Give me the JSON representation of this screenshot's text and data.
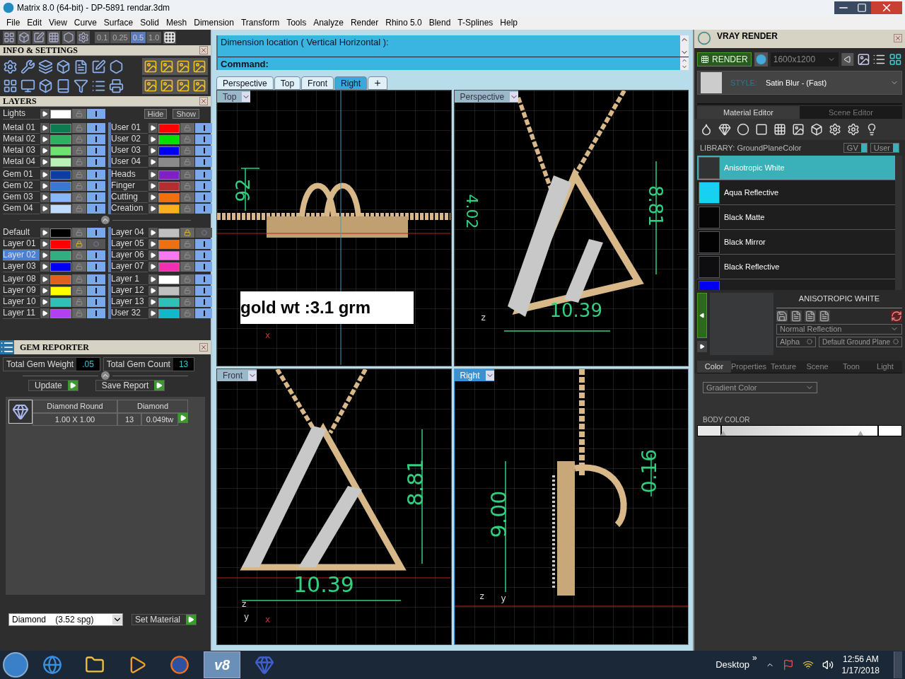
{
  "window": {
    "title": "Matrix 8.0 (64-bit) - DP-5891 rendar.3dm"
  },
  "menu": [
    "File",
    "Edit",
    "View",
    "Curve",
    "Surface",
    "Solid",
    "Mesh",
    "Dimension",
    "Transform",
    "Tools",
    "Analyze",
    "Render",
    "Rhino 5.0",
    "Blend",
    "T-Splines",
    "Help"
  ],
  "snap_values": [
    {
      "label": "0.1",
      "selected": false
    },
    {
      "label": "0.25",
      "selected": false
    },
    {
      "label": "0.5",
      "selected": true
    },
    {
      "label": "1.0",
      "selected": false
    }
  ],
  "info_panel": {
    "title": "INFO & SETTINGS"
  },
  "layers_panel": {
    "title": "LAYERS",
    "lights": {
      "name": "Lights",
      "color": "#ffffff",
      "locked": false,
      "visible": true,
      "selected": false
    },
    "hide_label": "Hide",
    "show_label": "Show",
    "groups": [
      {
        "left": [
          {
            "name": "Metal 01",
            "color": "#0f7a50",
            "locked": false,
            "visible": true,
            "selected": false
          },
          {
            "name": "Metal 02",
            "color": "#2fb060",
            "locked": false,
            "visible": true,
            "selected": false
          },
          {
            "name": "Metal 03",
            "color": "#70e070",
            "locked": false,
            "visible": true,
            "selected": false
          },
          {
            "name": "Metal 04",
            "color": "#b8f0b8",
            "locked": false,
            "visible": true,
            "selected": false
          }
        ],
        "right": [
          {
            "name": "User 01",
            "color": "#ff0000",
            "locked": false,
            "visible": true,
            "selected": false
          },
          {
            "name": "User 02",
            "color": "#00e000",
            "locked": false,
            "visible": true,
            "selected": false
          },
          {
            "name": "User 03",
            "color": "#0000ee",
            "locked": false,
            "visible": true,
            "selected": false
          },
          {
            "name": "User 04",
            "color": "#8a8a8a",
            "locked": false,
            "visible": true,
            "selected": false
          }
        ]
      },
      {
        "left": [
          {
            "name": "Gem 01",
            "color": "#0a3fa0",
            "locked": false,
            "visible": true,
            "selected": false
          },
          {
            "name": "Gem 02",
            "color": "#3a78d0",
            "locked": false,
            "visible": true,
            "selected": false
          },
          {
            "name": "Gem 03",
            "color": "#88b8f8",
            "locked": false,
            "visible": true,
            "selected": false
          },
          {
            "name": "Gem 04",
            "color": "#c0dcfc",
            "locked": false,
            "visible": true,
            "selected": false
          }
        ],
        "right": [
          {
            "name": "Heads",
            "color": "#8020c0",
            "locked": false,
            "visible": true,
            "selected": false
          },
          {
            "name": "Finger",
            "color": "#b03030",
            "locked": false,
            "visible": true,
            "selected": false
          },
          {
            "name": "Cutting",
            "color": "#f07010",
            "locked": false,
            "visible": true,
            "selected": false
          },
          {
            "name": "Creation",
            "color": "#f8b020",
            "locked": false,
            "visible": true,
            "selected": false
          }
        ]
      },
      {
        "left": [
          {
            "name": "Default",
            "color": "#000000",
            "locked": false,
            "visible": true,
            "selected": false
          },
          {
            "name": "Layer 01",
            "color": "#ff0000",
            "locked": true,
            "visible": false,
            "selected": false
          },
          {
            "name": "Layer 02",
            "color": "#30b080",
            "locked": false,
            "visible": true,
            "selected": true
          },
          {
            "name": "Layer 03",
            "color": "#0000ee",
            "locked": false,
            "visible": true,
            "selected": false
          }
        ],
        "right": [
          {
            "name": "Layer 04",
            "color": "#c0c0c0",
            "locked": true,
            "visible": false,
            "selected": false
          },
          {
            "name": "Layer 05",
            "color": "#f07010",
            "locked": false,
            "visible": true,
            "selected": false
          },
          {
            "name": "Layer 06",
            "color": "#f878f0",
            "locked": false,
            "visible": true,
            "selected": false
          },
          {
            "name": "Layer 07",
            "color": "#f030b0",
            "locked": false,
            "visible": true,
            "selected": false
          }
        ]
      },
      {
        "left": [
          {
            "name": "Layer 08",
            "color": "#e06020",
            "locked": false,
            "visible": true,
            "selected": false
          },
          {
            "name": "Layer 09",
            "color": "#ffff00",
            "locked": false,
            "visible": true,
            "selected": false
          },
          {
            "name": "Layer 10",
            "color": "#30c0b8",
            "locked": false,
            "visible": true,
            "selected": false
          },
          {
            "name": "Layer 11",
            "color": "#b040f0",
            "locked": false,
            "visible": true,
            "selected": false
          }
        ],
        "right": [
          {
            "name": "Layer 1",
            "color": "#ffffff",
            "locked": false,
            "visible": true,
            "selected": false
          },
          {
            "name": "Layer 12",
            "color": "#c0c0c0",
            "locked": false,
            "visible": true,
            "selected": false
          },
          {
            "name": "Layer 13",
            "color": "#30c0b8",
            "locked": false,
            "visible": true,
            "selected": false
          },
          {
            "name": "User 32",
            "color": "#10b8c8",
            "locked": false,
            "visible": true,
            "selected": false
          }
        ]
      }
    ]
  },
  "gem_reporter": {
    "title": "GEM REPORTER",
    "weight_label": "Total Gem Weight",
    "weight": ".05",
    "count_label": "Total Gem Count",
    "count": "13",
    "buttons": [
      "Update",
      "Save Report"
    ],
    "gems": [
      {
        "shape": "Diamond Round",
        "size": "1.00 X 1.00",
        "material": "Diamond",
        "count": "13",
        "weight": "0.049tw"
      }
    ],
    "material_select": "Diamond    (3.52 spg)",
    "set_material": "Set Material"
  },
  "command": {
    "history": "Dimension location ( Vertical  Horizontal ):",
    "prompt": "Command:"
  },
  "viewport_tabs": [
    {
      "label": "Perspective",
      "selected": false
    },
    {
      "label": "Top",
      "selected": false
    },
    {
      "label": "Front",
      "selected": false
    },
    {
      "label": "Right",
      "selected": true
    }
  ],
  "viewports": [
    {
      "kind": "top",
      "title": "Top",
      "active": false,
      "labels": [
        "92",
        "x"
      ],
      "note": "gold wt :3.1 grm"
    },
    {
      "kind": "perspective",
      "title": "Perspective",
      "active": false,
      "labels": [
        "4.02",
        "8.81",
        "z",
        "10.39"
      ]
    },
    {
      "kind": "front",
      "title": "Front",
      "active": false,
      "labels": [
        "8.81",
        "10.39",
        "z",
        "y",
        "x"
      ]
    },
    {
      "kind": "right",
      "title": "Right",
      "active": true,
      "labels": [
        "9.00",
        "0.16",
        "z",
        "y"
      ]
    }
  ],
  "vray": {
    "title": "VRAY RENDER",
    "render": "RENDER",
    "resolution": "1600x1200",
    "style_label": "STYLE:",
    "style": "Satin Blur - (Fast)",
    "tabs": [
      {
        "label": "Material Editor",
        "selected": true
      },
      {
        "label": "Scene Editor",
        "selected": false
      }
    ],
    "library": "LIBRARY: GroundPlaneColor",
    "toggles": [
      "GV",
      "User"
    ],
    "materials": [
      {
        "name": "Anisotropic White",
        "color": "#303234",
        "selected": true
      },
      {
        "name": "Aqua Reflective",
        "color": "#18d0f0",
        "selected": false
      },
      {
        "name": "Black Matte",
        "color": "#050505",
        "selected": false
      },
      {
        "name": "Black Mirror",
        "color": "#020202",
        "selected": false
      },
      {
        "name": "Black Reflective",
        "color": "#0e0e10",
        "selected": false
      },
      {
        "color": "#0000f0",
        "selected": false
      }
    ],
    "preview_title": "ANISOTROPIC WHITE",
    "reflection": "Normal Reflection",
    "alpha": "Alpha",
    "ground": "Default Ground Plane",
    "prop_tabs": [
      {
        "label": "Color",
        "selected": true
      },
      {
        "label": "Properties",
        "selected": false
      },
      {
        "label": "Texture",
        "selected": false
      },
      {
        "label": "Scene",
        "selected": false
      },
      {
        "label": "Toon",
        "selected": false
      },
      {
        "label": "Light",
        "selected": false
      }
    ],
    "color_mode": "Gradient Color",
    "body_color": "BODY COLOR",
    "stops": [
      {
        "level": 0.01
      },
      {
        "level": 0.89
      }
    ]
  },
  "taskbar": {
    "apps": [
      {
        "kind": "browser",
        "active": false
      },
      {
        "kind": "folder",
        "active": false
      },
      {
        "kind": "media",
        "active": false
      },
      {
        "kind": "firefox",
        "active": false
      },
      {
        "kind": "matrix",
        "label": "v8",
        "active": true
      },
      {
        "kind": "ring",
        "active": false
      }
    ],
    "more": "»",
    "desktop": "Desktop",
    "time": "12:56 AM",
    "date": "1/17/2018"
  }
}
